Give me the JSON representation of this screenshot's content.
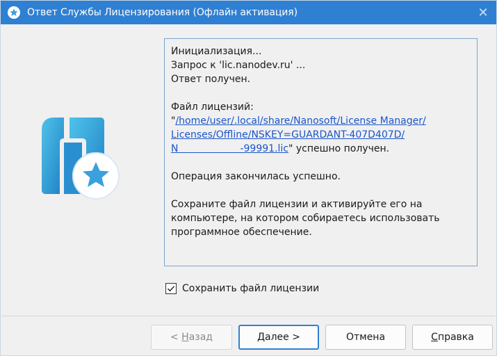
{
  "window": {
    "title": "Ответ Службы Лицензирования (Офлайн активация)",
    "close_glyph": "✕",
    "accent_color": "#2f80d2"
  },
  "log": {
    "line1": "Инициализация...",
    "line2": "Запрос к 'lic.nanodev.ru' ...",
    "line3": "Ответ получен.",
    "file_label": "Файл лицензий:",
    "quote_open": "\"",
    "path_line1": "/home/user/.local/share/Nanosoft/License Manager/",
    "path_line2": "Licenses/Offline/NSKEY=GUARDANT-407D407D/",
    "path_line3": "N                    -99991.lic",
    "path_suffix": "\" успешно получен.",
    "op_done": "Операция закончилась успешно.",
    "instr1": "Сохраните файл лицензии и активируйте его на",
    "instr2": "компьютере, на котором собираетесь использовать",
    "instr3": "программное обеспечение."
  },
  "save_checkbox": {
    "label": "Сохранить файл лицензии",
    "checked": true
  },
  "buttons": {
    "back_prefix": "< ",
    "back_hotkey": "Н",
    "back_rest": "азад",
    "next_hotkey": "Д",
    "next_rest": "алее >",
    "cancel": "Отмена",
    "help_hotkey": "С",
    "help_rest": "правка"
  },
  "icons": {
    "title": "app-star-icon",
    "logo": "nanosoft-logo-icon",
    "check": "checkmark-icon",
    "close": "close-icon"
  }
}
